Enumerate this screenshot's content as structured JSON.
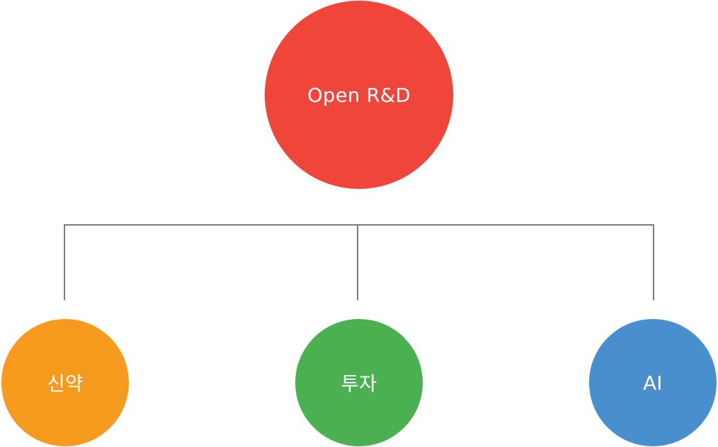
{
  "diagram": {
    "root": {
      "label": "Open R&D",
      "color": "#EF453A"
    },
    "children": [
      {
        "label": "신약",
        "color": "#F79B1E"
      },
      {
        "label": "투자",
        "color": "#4AB050"
      },
      {
        "label": "AI",
        "color": "#4A8FCD"
      }
    ],
    "connector_color": "#7A7A7A",
    "label_color": "#FFFFFF"
  }
}
